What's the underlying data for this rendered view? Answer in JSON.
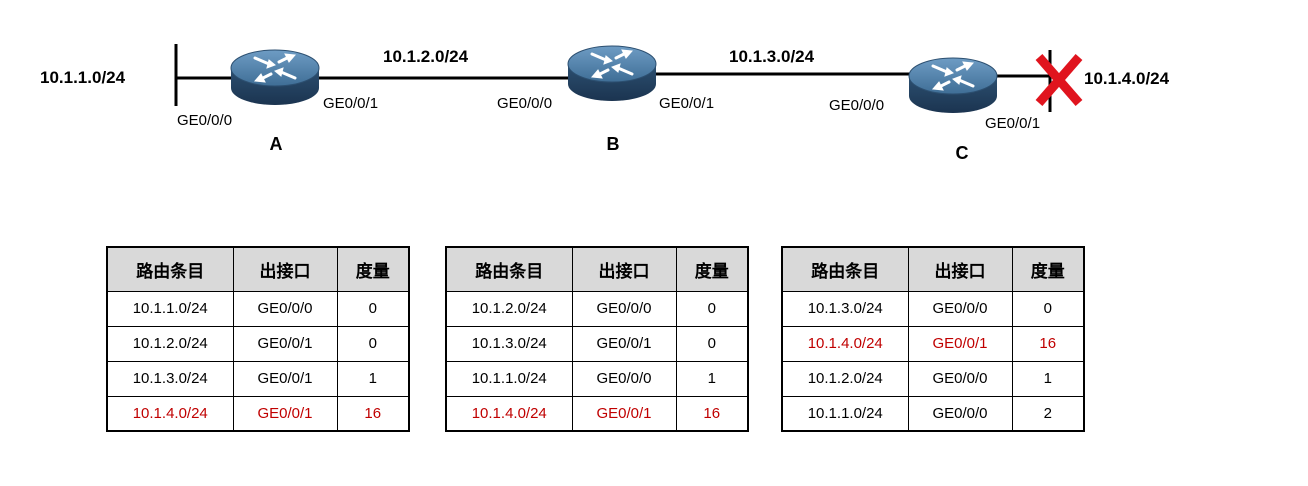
{
  "diagram": {
    "networks": [
      "10.1.1.0/24",
      "10.1.2.0/24",
      "10.1.3.0/24",
      "10.1.4.0/24"
    ],
    "routers": [
      {
        "name": "A",
        "left_if": "GE0/0/0",
        "right_if": "GE0/0/1"
      },
      {
        "name": "B",
        "left_if": "GE0/0/0",
        "right_if": "GE0/0/1"
      },
      {
        "name": "C",
        "left_if": "GE0/0/0",
        "right_if": "GE0/0/1"
      }
    ],
    "failure_marker_color": "#e0141e",
    "router_color": "#3f6e96"
  },
  "tables": [
    {
      "router": "A",
      "headers": [
        "路由条目",
        "出接口",
        "度量"
      ],
      "rows": [
        {
          "route": "10.1.1.0/24",
          "iface": "GE0/0/0",
          "metric": "0",
          "highlight": false
        },
        {
          "route": "10.1.2.0/24",
          "iface": "GE0/0/1",
          "metric": "0",
          "highlight": false
        },
        {
          "route": "10.1.3.0/24",
          "iface": "GE0/0/1",
          "metric": "1",
          "highlight": false
        },
        {
          "route": "10.1.4.0/24",
          "iface": "GE0/0/1",
          "metric": "16",
          "highlight": true
        }
      ]
    },
    {
      "router": "B",
      "headers": [
        "路由条目",
        "出接口",
        "度量"
      ],
      "rows": [
        {
          "route": "10.1.2.0/24",
          "iface": "GE0/0/0",
          "metric": "0",
          "highlight": false
        },
        {
          "route": "10.1.3.0/24",
          "iface": "GE0/0/1",
          "metric": "0",
          "highlight": false
        },
        {
          "route": "10.1.1.0/24",
          "iface": "GE0/0/0",
          "metric": "1",
          "highlight": false
        },
        {
          "route": "10.1.4.0/24",
          "iface": "GE0/0/1",
          "metric": "16",
          "highlight": true
        }
      ]
    },
    {
      "router": "C",
      "headers": [
        "路由条目",
        "出接口",
        "度量"
      ],
      "rows": [
        {
          "route": "10.1.3.0/24",
          "iface": "GE0/0/0",
          "metric": "0",
          "highlight": false
        },
        {
          "route": "10.1.4.0/24",
          "iface": "GE0/0/1",
          "metric": "16",
          "highlight": true
        },
        {
          "route": "10.1.2.0/24",
          "iface": "GE0/0/0",
          "metric": "1",
          "highlight": false
        },
        {
          "route": "10.1.1.0/24",
          "iface": "GE0/0/0",
          "metric": "2",
          "highlight": false
        }
      ]
    }
  ],
  "colors": {
    "highlight_text": "#c00000",
    "header_bg": "#d9d9d9"
  }
}
